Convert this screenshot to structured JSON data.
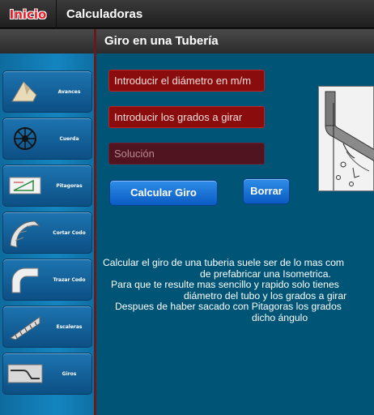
{
  "topbar": {
    "home_label": "Inicio",
    "title": "Calculadoras"
  },
  "sidebar": {
    "items": [
      {
        "label": "Avances",
        "icon": "avances-icon"
      },
      {
        "label": "Cuerda",
        "icon": "cuerda-icon"
      },
      {
        "label": "Pitagoras",
        "icon": "pitagoras-icon"
      },
      {
        "label": "Cortar Codo",
        "icon": "cortar-codo-icon"
      },
      {
        "label": "Trazar Codo",
        "icon": "trazar-codo-icon"
      },
      {
        "label": "Escaleras",
        "icon": "escaleras-icon"
      },
      {
        "label": "Giros",
        "icon": "giros-icon"
      }
    ]
  },
  "main": {
    "title": "Giro en una Tubería",
    "diameter_placeholder": "Introducir el diámetro en m/m",
    "degrees_placeholder": "Introducir los grados a girar",
    "solution_placeholder": "Solución",
    "calc_button": "Calcular Giro",
    "clear_button": "Borrar",
    "description": [
      "Calcular el giro de una tuberia suele ser de lo mas com",
      "de prefabricar una Isometrica.",
      "Para que te resulte mas sencillo y rapido solo tienes",
      "diámetro del tubo y los grados a girar",
      "Despues de haber sacado con Pitagoras los grados",
      "dicho ángulo"
    ]
  },
  "colors": {
    "accent_red": "#8a0c0c",
    "button_blue": "#1a75d6",
    "main_bg": "#005577"
  }
}
